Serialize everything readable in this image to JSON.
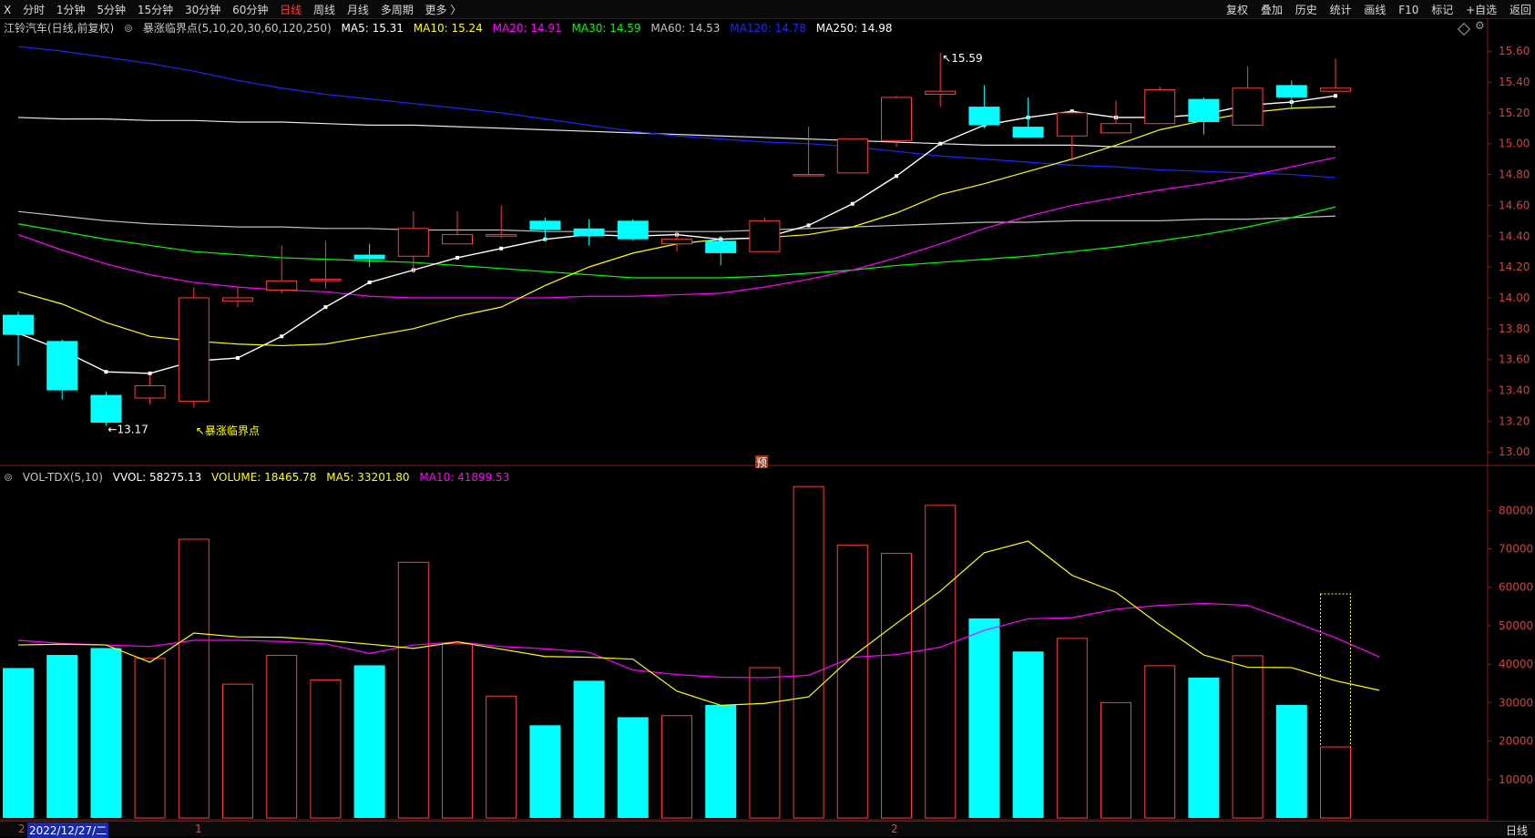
{
  "toolbar": {
    "left_icon": "X",
    "periods": [
      "分时",
      "1分钟",
      "5分钟",
      "15分钟",
      "30分钟",
      "60分钟",
      "日线",
      "周线",
      "月线",
      "多周期",
      "更多 〉"
    ],
    "active_period": "日线",
    "tools": [
      "复权",
      "叠加",
      "历史",
      "统计",
      "画线",
      "F10",
      "标记",
      "+自选",
      "返回"
    ]
  },
  "price_header": {
    "stock": "江铃汽车(日线,前复权)",
    "indicator": "暴涨临界点(5,10,20,30,60,120,250)",
    "mas": [
      {
        "label": "MA5: 15.31",
        "color": "#ffffff"
      },
      {
        "label": "MA10: 15.24",
        "color": "#ffff00"
      },
      {
        "label": "MA20: 14.91",
        "color": "#ff00ff"
      },
      {
        "label": "MA30: 14.59",
        "color": "#00ff00"
      },
      {
        "label": "MA60: 14.53",
        "color": "#c0c0c0"
      },
      {
        "label": "MA120: 14.78",
        "color": "#2222ff"
      },
      {
        "label": "MA250: 14.98",
        "color": "#ffffff"
      }
    ]
  },
  "volume_header": {
    "indicator": "VOL-TDX(5,10)",
    "items": [
      {
        "label": "VVOL: 58275.13",
        "color": "#ffffff"
      },
      {
        "label": "VOLUME: 18465.78",
        "color": "#ffff00"
      },
      {
        "label": "MA5: 33201.80",
        "color": "#ffff00"
      },
      {
        "label": "MA10: 41899.53",
        "color": "#ff00ff"
      }
    ]
  },
  "annotations": {
    "high_label": "15.59",
    "low_label": "13.17",
    "signal_label": "暴涨临界点",
    "pre_marker": "预"
  },
  "status": {
    "left_mark": "2",
    "date": "2022/12/27/二",
    "month_marks": [
      "1",
      "2"
    ],
    "right": "日线"
  },
  "colors": {
    "up": "#ff3b3b",
    "down": "#00ffff",
    "ma5": "#ffffff",
    "ma10": "#ffff00",
    "ma20": "#ff00ff",
    "ma30": "#00ff00",
    "ma60": "#c0c0c0",
    "ma120": "#2222ff",
    "ma250": "#ffffff"
  },
  "chart_data": {
    "type": "candlestick",
    "price_axis_ticks": [
      13.0,
      13.2,
      13.4,
      13.6,
      13.8,
      14.0,
      14.2,
      14.4,
      14.6,
      14.8,
      15.0,
      15.2,
      15.4,
      15.6
    ],
    "price_ylim": [
      12.96,
      15.66
    ],
    "volume_axis_ticks": [
      10000,
      20000,
      30000,
      40000,
      50000,
      60000,
      70000,
      80000
    ],
    "volume_ylim": [
      0,
      86000
    ],
    "candles": [
      {
        "o": 13.89,
        "h": 13.91,
        "l": 13.56,
        "c": 13.76
      },
      {
        "o": 13.72,
        "h": 13.73,
        "l": 13.34,
        "c": 13.4
      },
      {
        "o": 13.37,
        "h": 13.39,
        "l": 13.17,
        "c": 13.19
      },
      {
        "o": 13.35,
        "h": 13.5,
        "l": 13.31,
        "c": 13.43
      },
      {
        "o": 13.33,
        "h": 14.07,
        "l": 13.29,
        "c": 14.0
      },
      {
        "o": 13.98,
        "h": 14.07,
        "l": 13.94,
        "c": 14.0
      },
      {
        "o": 14.05,
        "h": 14.34,
        "l": 14.03,
        "c": 14.11
      },
      {
        "o": 14.12,
        "h": 14.37,
        "l": 14.06,
        "c": 14.12
      },
      {
        "o": 14.28,
        "h": 14.35,
        "l": 14.2,
        "c": 14.25
      },
      {
        "o": 14.27,
        "h": 14.56,
        "l": 14.16,
        "c": 14.45
      },
      {
        "o": 14.35,
        "h": 14.56,
        "l": 14.35,
        "c": 14.41
      },
      {
        "o": 14.4,
        "h": 14.6,
        "l": 14.39,
        "c": 14.41
      },
      {
        "o": 14.5,
        "h": 14.52,
        "l": 14.37,
        "c": 14.44
      },
      {
        "o": 14.45,
        "h": 14.51,
        "l": 14.34,
        "c": 14.4
      },
      {
        "o": 14.5,
        "h": 14.51,
        "l": 14.37,
        "c": 14.38
      },
      {
        "o": 14.35,
        "h": 14.42,
        "l": 14.3,
        "c": 14.38
      },
      {
        "o": 14.37,
        "h": 14.4,
        "l": 14.21,
        "c": 14.29
      },
      {
        "o": 14.3,
        "h": 14.52,
        "l": 14.3,
        "c": 14.5
      },
      {
        "o": 14.8,
        "h": 15.11,
        "l": 14.8,
        "c": 14.8
      },
      {
        "o": 14.81,
        "h": 15.03,
        "l": 14.81,
        "c": 15.03
      },
      {
        "o": 15.02,
        "h": 15.31,
        "l": 14.98,
        "c": 15.3
      },
      {
        "o": 15.32,
        "h": 15.59,
        "l": 15.24,
        "c": 15.34
      },
      {
        "o": 15.24,
        "h": 15.38,
        "l": 15.1,
        "c": 15.12
      },
      {
        "o": 15.11,
        "h": 15.3,
        "l": 15.04,
        "c": 15.04
      },
      {
        "o": 15.05,
        "h": 15.21,
        "l": 14.89,
        "c": 15.2
      },
      {
        "o": 15.07,
        "h": 15.28,
        "l": 15.07,
        "c": 15.13
      },
      {
        "o": 15.13,
        "h": 15.37,
        "l": 15.13,
        "c": 15.35
      },
      {
        "o": 15.29,
        "h": 15.3,
        "l": 15.06,
        "c": 15.14
      },
      {
        "o": 15.12,
        "h": 15.5,
        "l": 15.12,
        "c": 15.36
      },
      {
        "o": 15.38,
        "h": 15.41,
        "l": 15.22,
        "c": 15.3
      },
      {
        "o": 15.34,
        "h": 15.55,
        "l": 15.34,
        "c": 15.36
      }
    ],
    "ma5": [
      13.77,
      13.66,
      13.52,
      13.51,
      13.59,
      13.61,
      13.75,
      13.94,
      14.1,
      14.18,
      14.26,
      14.32,
      14.38,
      14.41,
      14.4,
      14.41,
      14.38,
      14.39,
      14.47,
      14.61,
      14.79,
      15.0,
      15.12,
      15.17,
      15.21,
      15.17,
      15.17,
      15.19,
      15.25,
      15.27,
      15.31
    ],
    "ma10": [
      14.04,
      13.96,
      13.84,
      13.75,
      13.72,
      13.7,
      13.69,
      13.7,
      13.75,
      13.8,
      13.88,
      13.94,
      14.08,
      14.2,
      14.29,
      14.35,
      14.38,
      14.39,
      14.41,
      14.46,
      14.55,
      14.67,
      14.74,
      14.82,
      14.9,
      14.99,
      15.09,
      15.15,
      15.2,
      15.23,
      15.24
    ],
    "ma20": [
      14.41,
      14.31,
      14.22,
      14.15,
      14.1,
      14.07,
      14.05,
      14.04,
      14.01,
      14.0,
      14.0,
      14.0,
      14.0,
      14.01,
      14.01,
      14.02,
      14.03,
      14.07,
      14.12,
      14.18,
      14.26,
      14.35,
      14.45,
      14.53,
      14.6,
      14.65,
      14.7,
      14.74,
      14.79,
      14.85,
      14.91
    ],
    "ma30": [
      14.48,
      14.43,
      14.38,
      14.34,
      14.3,
      14.28,
      14.26,
      14.25,
      14.24,
      14.23,
      14.21,
      14.19,
      14.17,
      14.15,
      14.13,
      14.13,
      14.13,
      14.14,
      14.16,
      14.18,
      14.21,
      14.23,
      14.25,
      14.27,
      14.3,
      14.33,
      14.37,
      14.41,
      14.46,
      14.52,
      14.59
    ],
    "ma60": [
      14.56,
      14.53,
      14.5,
      14.48,
      14.47,
      14.46,
      14.46,
      14.45,
      14.45,
      14.44,
      14.44,
      14.44,
      14.43,
      14.43,
      14.43,
      14.43,
      14.43,
      14.44,
      14.45,
      14.46,
      14.47,
      14.48,
      14.49,
      14.49,
      14.5,
      14.5,
      14.5,
      14.51,
      14.51,
      14.52,
      14.53
    ],
    "ma120": [
      15.63,
      15.6,
      15.56,
      15.52,
      15.47,
      15.41,
      15.36,
      15.32,
      15.29,
      15.26,
      15.23,
      15.2,
      15.16,
      15.12,
      15.08,
      15.05,
      15.03,
      15.01,
      15.0,
      14.98,
      14.95,
      14.92,
      14.9,
      14.88,
      14.86,
      14.85,
      14.83,
      14.82,
      14.81,
      14.8,
      14.78
    ],
    "ma250": [
      15.17,
      15.16,
      15.16,
      15.15,
      15.15,
      15.14,
      15.14,
      15.13,
      15.12,
      15.12,
      15.11,
      15.1,
      15.09,
      15.08,
      15.07,
      15.06,
      15.05,
      15.04,
      15.03,
      15.02,
      15.01,
      15.0,
      14.99,
      14.99,
      14.99,
      14.98,
      14.98,
      14.98,
      14.98,
      14.98,
      14.98
    ],
    "volume": [
      39000,
      42400,
      44200,
      41500,
      72500,
      34800,
      42300,
      35900,
      39700,
      66500,
      45300,
      31700,
      24100,
      35700,
      26200,
      26600,
      29400,
      39100,
      86200,
      71000,
      68800,
      81300,
      51900,
      43300,
      46700,
      30000,
      39600,
      36500,
      42200,
      29400,
      18466
    ],
    "vol_ma5": [
      45000,
      45200,
      45000,
      40500,
      48100,
      47100,
      47000,
      46200,
      45200,
      44100,
      45800,
      43900,
      42000,
      41800,
      41300,
      33000,
      29300,
      29800,
      31500,
      42000,
      50600,
      59000,
      69000,
      72000,
      63100,
      58700,
      50200,
      42400,
      39200,
      39100,
      35700,
      33200
    ],
    "vol_ma10": [
      46200,
      45400,
      45000,
      44600,
      46200,
      46200,
      45900,
      45300,
      42800,
      45000,
      45800,
      44600,
      44000,
      43100,
      38500,
      37300,
      36600,
      36500,
      37100,
      41800,
      42500,
      44400,
      48800,
      51800,
      52100,
      54300,
      55300,
      55800,
      55300,
      51200,
      46900,
      41900
    ]
  }
}
